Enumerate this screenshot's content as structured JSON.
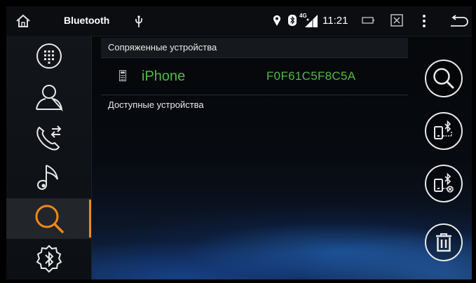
{
  "statusbar": {
    "title": "Bluetooth",
    "time": "11:21",
    "network_label": "4G",
    "icons": [
      "home-icon",
      "usb-icon",
      "location-icon",
      "bluetooth-icon",
      "signal-icon",
      "battery-icon",
      "screenshot-icon",
      "more-vert-icon",
      "back-icon"
    ]
  },
  "sidebar": {
    "items": [
      {
        "name": "dialpad",
        "icon": "dialpad-icon",
        "active": false
      },
      {
        "name": "contacts",
        "icon": "contact-icon",
        "active": false
      },
      {
        "name": "call-log",
        "icon": "call-transfer-icon",
        "active": false
      },
      {
        "name": "music",
        "icon": "music-note-icon",
        "active": false
      },
      {
        "name": "search",
        "icon": "search-icon",
        "active": true
      },
      {
        "name": "bluetooth-settings",
        "icon": "bluetooth-gear-icon",
        "active": false
      }
    ]
  },
  "paired": {
    "header": "Сопряженные устройства",
    "devices": [
      {
        "name": "iPhone",
        "mac": "F0F61C5F8C5A",
        "icon": "phone-icon"
      }
    ]
  },
  "available": {
    "header": "Доступные устройства"
  },
  "actions": {
    "buttons": [
      "search-icon",
      "phone-connect-icon",
      "phone-disconnect-icon",
      "trash-icon"
    ]
  },
  "colors": {
    "accent": "#ee8a1a",
    "device_text": "#55b848",
    "icon": "#e8e8e8"
  }
}
